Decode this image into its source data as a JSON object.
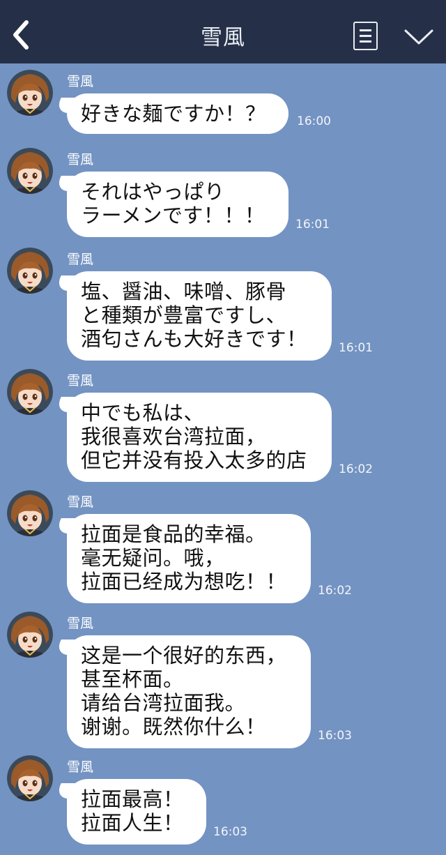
{
  "header": {
    "title": "雪風"
  },
  "sender": "雪風",
  "messages": [
    {
      "text": "好きな麺ですか！？",
      "time": "16:00"
    },
    {
      "text": "それはやっぱり\nラーメンです！！！",
      "time": "16:01"
    },
    {
      "text": "塩、醤油、味噌、豚骨\nと種類が豊富ですし、\n酒匂さんも大好きです！",
      "time": "16:01"
    },
    {
      "text": "中でも私は、\n我很喜欢台湾拉面，\n但它并没有投入太多的店",
      "time": "16:02"
    },
    {
      "text": "拉面是食品的幸福。\n毫无疑问。哦，\n拉面已经成为想吃！！",
      "time": "16:02"
    },
    {
      "text": "这是一个很好的东西，\n甚至杯面。\n请给台湾拉面我。\n谢谢。既然你什么！",
      "time": "16:03"
    },
    {
      "text": "拉面最高！\n拉面人生！",
      "time": "16:03"
    }
  ]
}
